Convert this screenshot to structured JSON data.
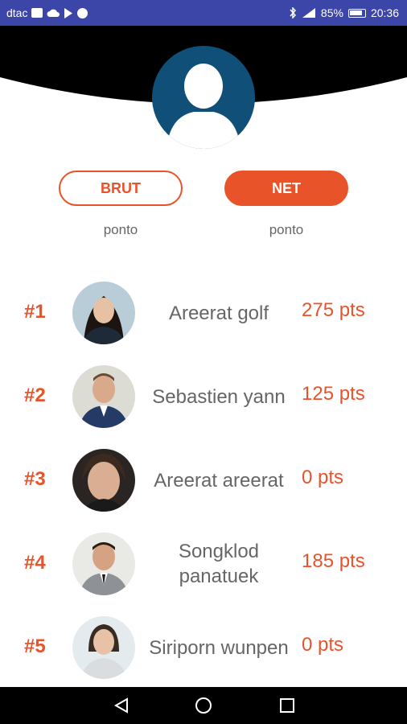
{
  "status_bar": {
    "carrier": "dtac",
    "battery": "85%",
    "time": "20:36",
    "icons": [
      "sim-icon",
      "cloud-icon",
      "play-store-icon",
      "vpn-icon",
      "bluetooth-icon",
      "signal-icon",
      "battery-icon"
    ]
  },
  "profile": {
    "avatar_icon": "default-user-avatar",
    "colors": {
      "avatar_bg": "#0f4f78",
      "header_bg": "#000000",
      "accent": "#e8532a"
    }
  },
  "toggle": {
    "brut_label": "BRUT",
    "net_label": "NET",
    "selected": "NET",
    "brut_sub": "ponto",
    "net_sub": "ponto"
  },
  "leaderboard": [
    {
      "rank": "#1",
      "name": "Areerat golf",
      "points": "275 pts",
      "avatar": "woman-photo-1"
    },
    {
      "rank": "#2",
      "name": "Sebastien yann",
      "points": "125 pts",
      "avatar": "man-photo-1"
    },
    {
      "rank": "#3",
      "name": "Areerat areerat",
      "points": "0 pts",
      "avatar": "woman-photo-2"
    },
    {
      "rank": "#4",
      "name": "Songklod panatuek",
      "points": "185 pts",
      "avatar": "man-photo-2"
    },
    {
      "rank": "#5",
      "name": "Siriporn wunpen",
      "points": "0 pts",
      "avatar": "woman-photo-3"
    }
  ],
  "nav_bar": {
    "back_icon": "back-icon",
    "home_icon": "home-icon",
    "recents_icon": "recents-icon"
  }
}
